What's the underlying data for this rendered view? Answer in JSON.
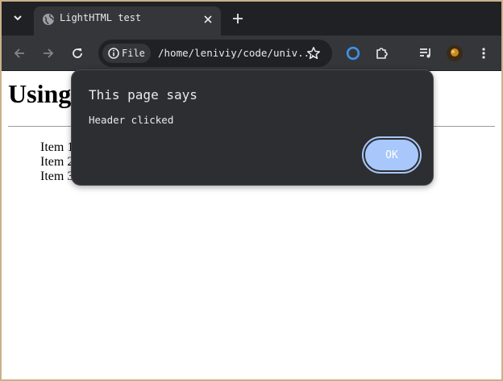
{
  "browser": {
    "tab": {
      "title": "LightHTML test"
    },
    "omnibox": {
      "chip_label": "File",
      "url": "/home/leniviy/code/univ..."
    }
  },
  "page": {
    "heading": "Using",
    "items": [
      "Item 1",
      "Item 2",
      "Item 3"
    ]
  },
  "dialog": {
    "heading": "This page says",
    "message": "Header clicked",
    "ok_label": "OK"
  },
  "colors": {
    "tabstrip_bg": "#202124",
    "toolbar_bg": "#35363a",
    "dialog_bg": "#2d2e31",
    "ok_button": "#a8c7fa"
  },
  "icons": {
    "tab_search": "chevron-down-icon",
    "favicon": "globe-icon",
    "close": "close-icon",
    "new_tab": "plus-icon",
    "back": "arrow-left-icon",
    "forward": "arrow-right-icon",
    "reload": "reload-icon",
    "info": "info-icon",
    "bookmark": "star-icon",
    "extension_1": "ring-icon",
    "extensions": "puzzle-icon",
    "media": "media-queue-icon",
    "profile": "avatar",
    "menu": "kebab-menu-icon"
  }
}
